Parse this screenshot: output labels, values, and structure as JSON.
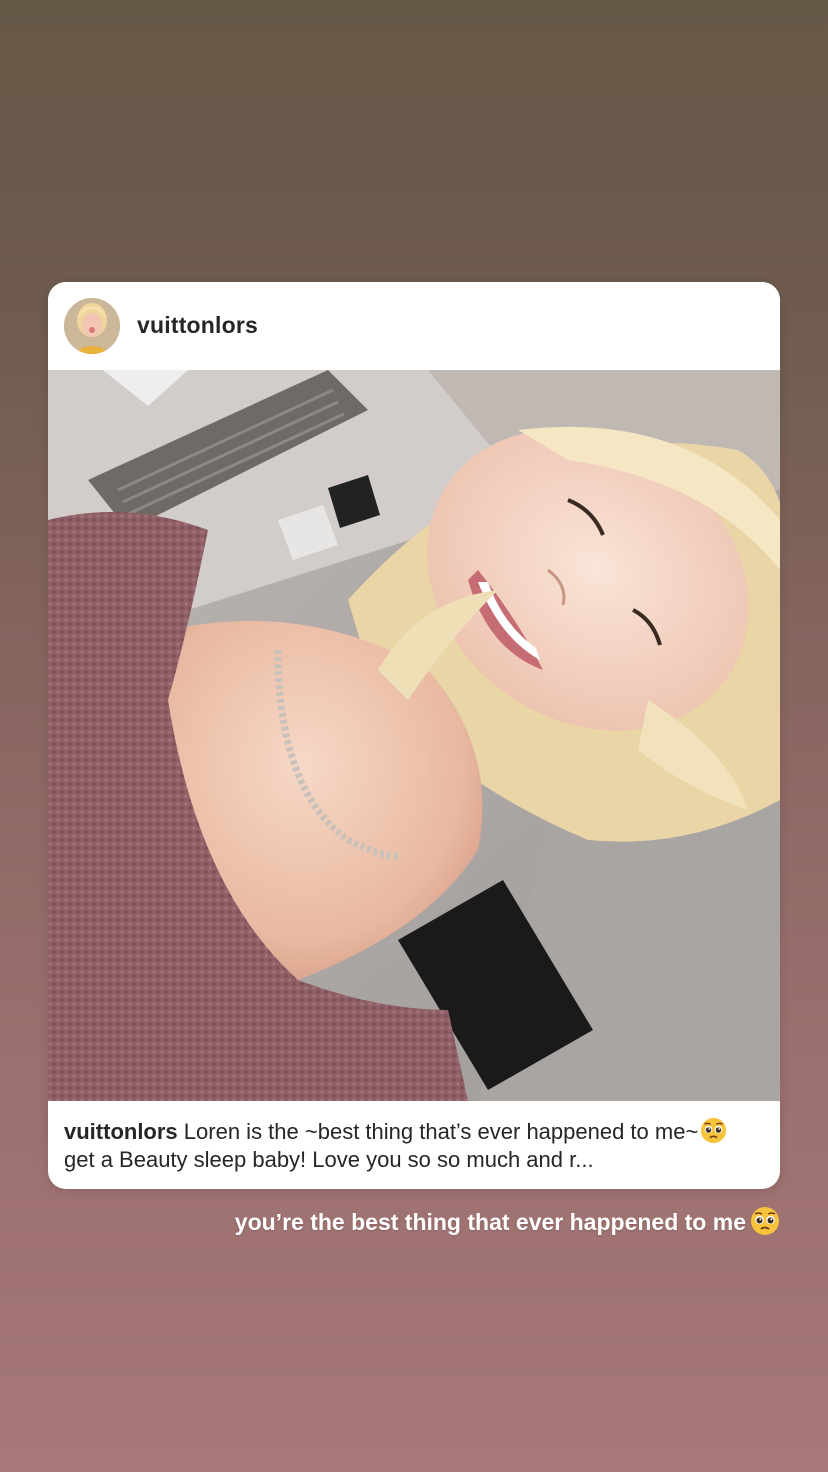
{
  "post": {
    "username": "vuittonlors",
    "avatar_icon": "profile-photo",
    "caption_user": "vuittonlors",
    "caption_line1": "Loren is the ~best thing that’s ever happened to",
    "caption_pre_emoji": "me~",
    "caption_emoji": "pleading-face-emoji",
    "caption_post_emoji": "get a Beauty sleep baby! Love you so so much and r..."
  },
  "story": {
    "text": "you’re the best thing that ever happened to me",
    "emoji": "pleading-face-emoji"
  },
  "colors": {
    "background_top": "#665847",
    "background_bottom": "#a67878",
    "card": "#ffffff",
    "text_dark": "#262626",
    "story_text": "#ffffff"
  }
}
